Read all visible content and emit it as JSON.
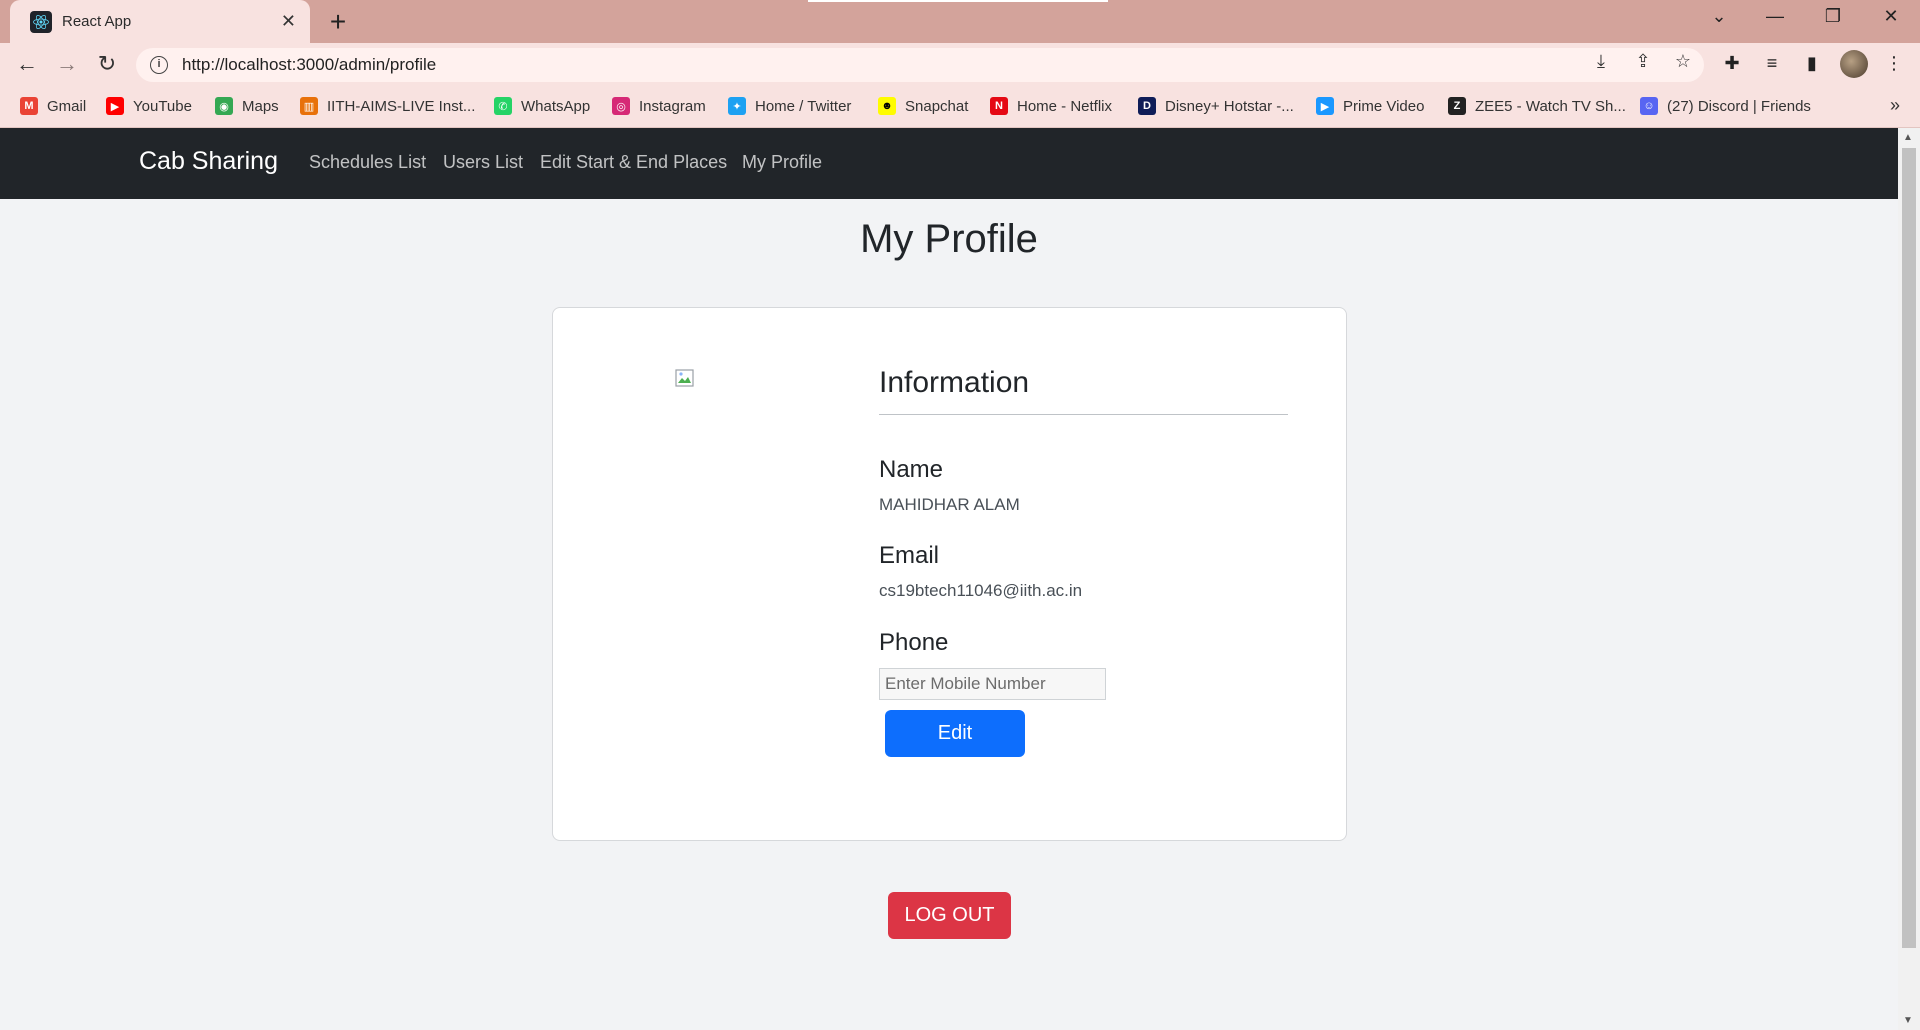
{
  "browser": {
    "tab_title": "React App",
    "url": "http://localhost:3000/admin/profile",
    "bookmarks": [
      {
        "label": "Gmail",
        "icon": "gmail-icon",
        "color": "#ea4335"
      },
      {
        "label": "YouTube",
        "icon": "youtube-icon",
        "color": "#ff0000"
      },
      {
        "label": "Maps",
        "icon": "maps-icon",
        "color": "#34a853"
      },
      {
        "label": "IITH-AIMS-LIVE Inst...",
        "icon": "iith-icon",
        "color": "#e8710a"
      },
      {
        "label": "WhatsApp",
        "icon": "whatsapp-icon",
        "color": "#25d366"
      },
      {
        "label": "Instagram",
        "icon": "instagram-icon",
        "color": "#d62976"
      },
      {
        "label": "Home / Twitter",
        "icon": "twitter-icon",
        "color": "#1da1f2"
      },
      {
        "label": "Snapchat",
        "icon": "snapchat-icon",
        "color": "#fffc00"
      },
      {
        "label": "Home - Netflix",
        "icon": "netflix-icon",
        "color": "#e50914"
      },
      {
        "label": "Disney+ Hotstar -...",
        "icon": "hotstar-icon",
        "color": "#0f1d58"
      },
      {
        "label": "Prime Video",
        "icon": "prime-video-icon",
        "color": "#1a98ff"
      },
      {
        "label": "ZEE5 - Watch TV Sh...",
        "icon": "zee5-icon",
        "color": "#222222"
      },
      {
        "label": "(27) Discord | Friends",
        "icon": "discord-icon",
        "color": "#5865f2"
      }
    ]
  },
  "navbar": {
    "brand": "Cab Sharing",
    "links": [
      "Schedules List",
      "Users List",
      "Edit Start & End Places",
      "My Profile"
    ]
  },
  "page": {
    "title": "My Profile",
    "info_heading": "Information",
    "name_label": "Name",
    "name_value": "MAHIDHAR ALAM",
    "email_label": "Email",
    "email_value": "cs19btech11046@iith.ac.in",
    "phone_label": "Phone",
    "phone_placeholder": "Enter Mobile Number",
    "edit_label": "Edit",
    "logout_label": "LOG OUT"
  },
  "colors": {
    "navbar_bg": "#212529",
    "primary": "#0d6efd",
    "danger": "#dc3545",
    "page_bg": "#f2f3f5"
  }
}
